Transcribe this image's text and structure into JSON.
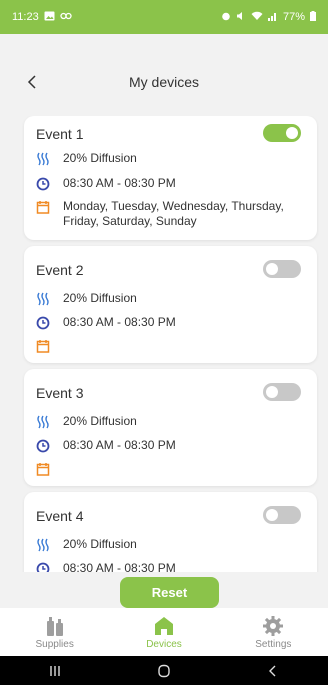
{
  "status_bar": {
    "time": "11:23",
    "battery": "77%"
  },
  "header": {
    "title": "My devices"
  },
  "events": [
    {
      "title": "Event 1",
      "enabled": true,
      "diffusion": "20% Diffusion",
      "time_range": "08:30 AM - 08:30 PM",
      "days": "Monday, Tuesday, Wednesday, Thursday, Friday, Saturday, Sunday"
    },
    {
      "title": "Event 2",
      "enabled": false,
      "diffusion": "20% Diffusion",
      "time_range": "08:30 AM - 08:30 PM",
      "days": ""
    },
    {
      "title": "Event 3",
      "enabled": false,
      "diffusion": "20% Diffusion",
      "time_range": "08:30 AM - 08:30 PM",
      "days": ""
    },
    {
      "title": "Event 4",
      "enabled": false,
      "diffusion": "20% Diffusion",
      "time_range": "08:30 AM - 08:30 PM",
      "days": ""
    }
  ],
  "reset_label": "Reset",
  "bottom_nav": [
    {
      "label": "Supplies",
      "icon": "supplies-icon",
      "active": false
    },
    {
      "label": "Devices",
      "icon": "home-icon",
      "active": true
    },
    {
      "label": "Settings",
      "icon": "gear-icon",
      "active": false
    }
  ],
  "colors": {
    "accent": "#8bc34a",
    "diffusion_icon": "#3a7bd5",
    "clock_icon": "#3949ab",
    "calendar_icon": "#f08a24"
  }
}
